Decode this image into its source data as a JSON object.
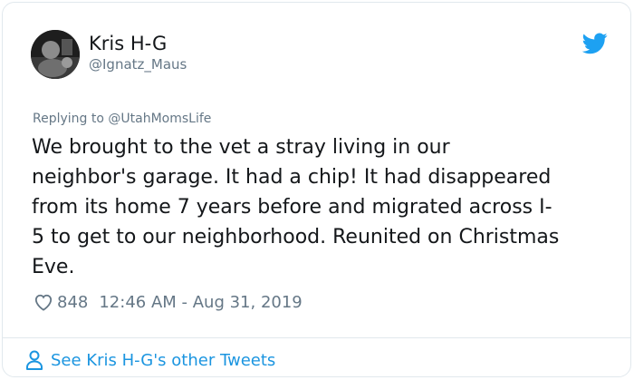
{
  "tweet": {
    "author": {
      "display_name": "Kris H-G",
      "handle": "@Ignatz_Maus",
      "avatar_icon": "user-photo"
    },
    "brand_icon": "twitter-bird-icon",
    "brand_color": "#1da1f2",
    "replying_to": "Replying to @UtahMomsLife",
    "text": "We brought to the vet a stray living in our\nneighbor's garage. It had a chip! It had disappeared\nfrom its home 7 years before and migrated across I-\n5 to get to our neighborhood. Reunited on Christmas\nEve.",
    "likes": "848",
    "timestamp": "12:46 AM - Aug 31, 2019",
    "like_icon": "heart-outline-icon"
  },
  "footer": {
    "see_more_label": "See Kris H-G's other Tweets",
    "see_more_icon": "person-outline-icon",
    "link_color": "#1b95e0"
  }
}
